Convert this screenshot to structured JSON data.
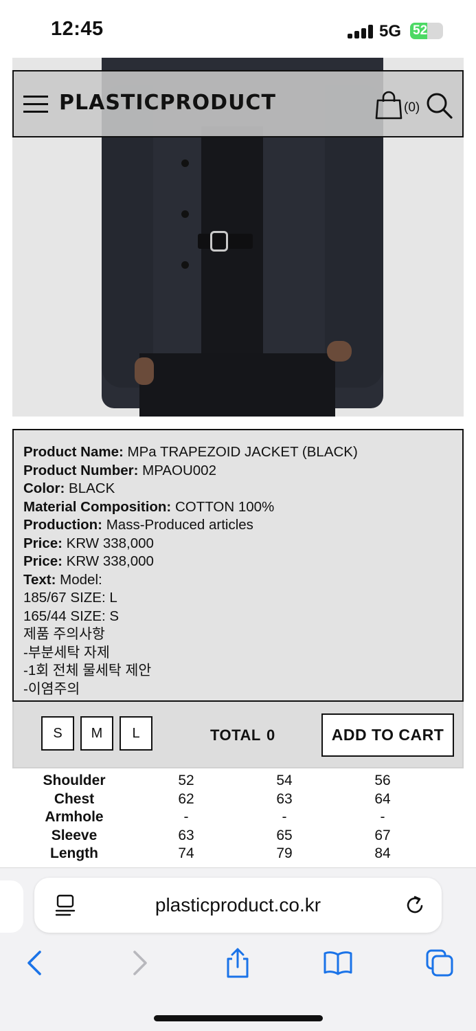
{
  "status_bar": {
    "time": "12:45",
    "network": "5G",
    "battery": "52",
    "battery_level": 0.52,
    "signal_bars": 4
  },
  "header": {
    "logo": "PLASTICPRODUCT",
    "cart_count": "(0)",
    "icons": [
      "menu-icon",
      "shopping-bag-icon",
      "search-icon"
    ]
  },
  "product": {
    "lines": [
      {
        "label": "Product Name:",
        "value": " MPa TRAPEZOID JACKET (BLACK)"
      },
      {
        "label": "Product Number:",
        "value": " MPAOU002"
      },
      {
        "label": "Color:",
        "value": " BLACK"
      },
      {
        "label": "Material Composition:",
        "value": " COTTON 100%"
      },
      {
        "label": "Production:",
        "value": " Mass-Produced articles"
      },
      {
        "label": "Price:",
        "value": " KRW 338,000"
      },
      {
        "label": "Price:",
        "value": " KRW 338,000"
      },
      {
        "label": "Text:",
        "value": " Model:"
      }
    ],
    "text_lines": [
      "185/67 SIZE: L",
      "165/44 SIZE: S",
      "제품 주의사항",
      "-부분세탁 자제",
      "-1회 전체 물세탁 제안",
      "-이염주의"
    ]
  },
  "purchase": {
    "sizes": [
      "S",
      "M",
      "L"
    ],
    "total_label": "TOTAL",
    "total_value": "0",
    "add_to_cart": "ADD TO CART"
  },
  "size_table": {
    "rows": [
      {
        "label": "Shoulder",
        "values": [
          "52",
          "54",
          "56"
        ]
      },
      {
        "label": "Chest",
        "values": [
          "62",
          "63",
          "64"
        ]
      },
      {
        "label": "Armhole",
        "values": [
          "-",
          "-",
          "-"
        ]
      },
      {
        "label": "Sleeve",
        "values": [
          "63",
          "65",
          "67"
        ]
      },
      {
        "label": "Length",
        "values": [
          "74",
          "79",
          "84"
        ]
      }
    ]
  },
  "browser": {
    "url": "plasticproduct.co.kr",
    "accent_color": "#1a73e8",
    "toolbar_icons": [
      "back-icon",
      "forward-icon",
      "share-icon",
      "bookmarks-icon",
      "tabs-icon"
    ]
  }
}
